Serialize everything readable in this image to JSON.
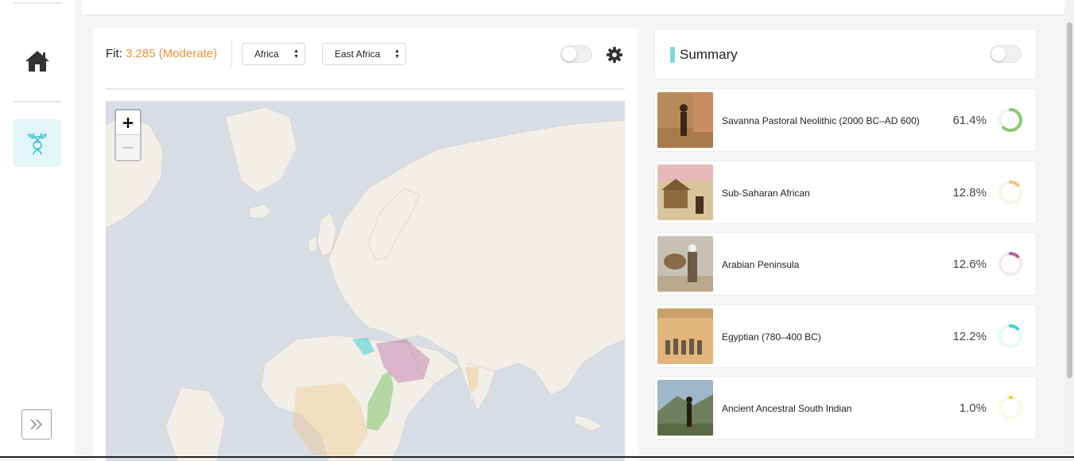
{
  "sidebar": {
    "items": [
      {
        "name": "home-icon"
      },
      {
        "name": "dna-plant-icon",
        "active": true,
        "accent": "#e2f5f7"
      },
      {
        "name": "expand-chevrons-icon"
      }
    ]
  },
  "fit": {
    "label": "Fit:",
    "value": "3.285 (Moderate)",
    "value_color": "#e8943a"
  },
  "filters": {
    "region": "Africa",
    "subregion": "East Africa"
  },
  "map": {
    "zoom_in": "+",
    "zoom_out": "−",
    "water_color": "#aad3df",
    "land_color": "#f2efe9"
  },
  "summary": {
    "title": "Summary",
    "accent": "#7dd7df",
    "rows": [
      {
        "name": "Savanna Pastoral Neolithic (2000 BC–AD 600)",
        "percent": "61.4%",
        "fraction": 0.614,
        "color": "#8cc776"
      },
      {
        "name": "Sub-Saharan African",
        "percent": "12.8%",
        "fraction": 0.128,
        "color": "#f0c27b"
      },
      {
        "name": "Arabian Peninsula",
        "percent": "12.6%",
        "fraction": 0.126,
        "color": "#b9629c"
      },
      {
        "name": "Egyptian (780–400 BC)",
        "percent": "12.2%",
        "fraction": 0.122,
        "color": "#3fd0d4"
      },
      {
        "name": "Ancient Ancestral South Indian",
        "percent": "1.0%",
        "fraction": 0.01,
        "color": "#f2c94c"
      }
    ]
  }
}
